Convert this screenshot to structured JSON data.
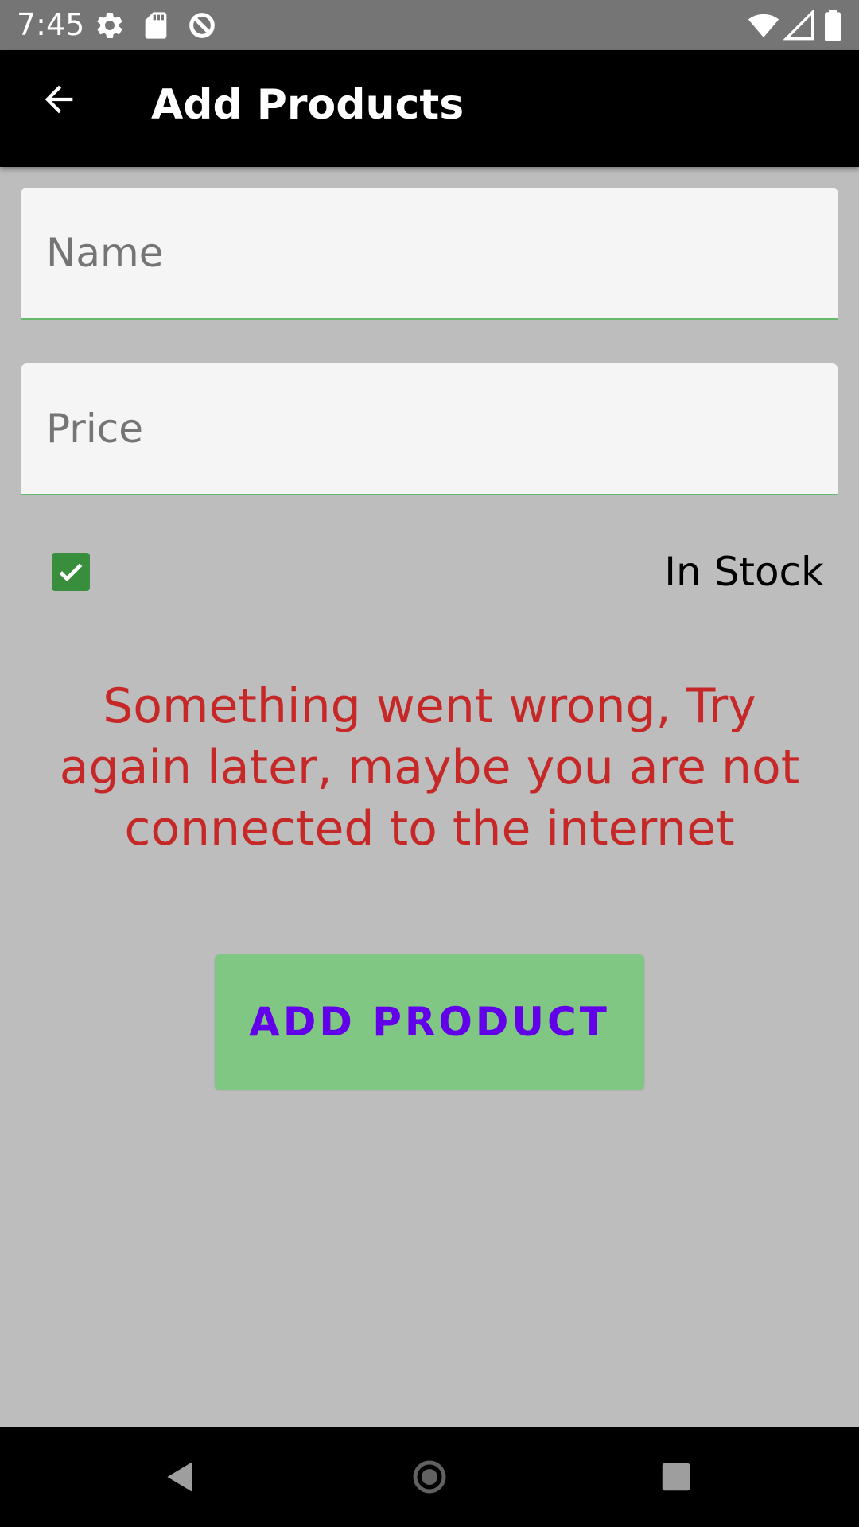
{
  "status_bar": {
    "time": "7:45",
    "left_icons": [
      "settings-icon",
      "sd-card-icon",
      "data-saver-icon"
    ],
    "right_icons": [
      "wifi-icon",
      "cell-signal-icon",
      "battery-icon"
    ]
  },
  "app_bar": {
    "title": "Add Products",
    "back_icon": "arrow-back-icon"
  },
  "form": {
    "name_field": {
      "placeholder": "Name",
      "value": ""
    },
    "price_field": {
      "placeholder": "Price",
      "value": ""
    },
    "in_stock": {
      "label": "In Stock",
      "checked": true
    }
  },
  "error": {
    "message": "Something went wrong, Try again later, maybe you are not connected to the internet"
  },
  "add_button": {
    "label": "ADD PRODUCT"
  },
  "nav_bar": {
    "icons": [
      "back-triangle-icon",
      "home-circle-icon",
      "recents-square-icon"
    ]
  },
  "colors": {
    "status_bar": "#757575",
    "app_bar": "#000000",
    "background": "#bdbdbd",
    "field_underline": "#66bb6a",
    "checkbox": "#388e3c",
    "error_text": "#c62828",
    "button_bg": "#81c784",
    "button_text": "#6200ea"
  }
}
